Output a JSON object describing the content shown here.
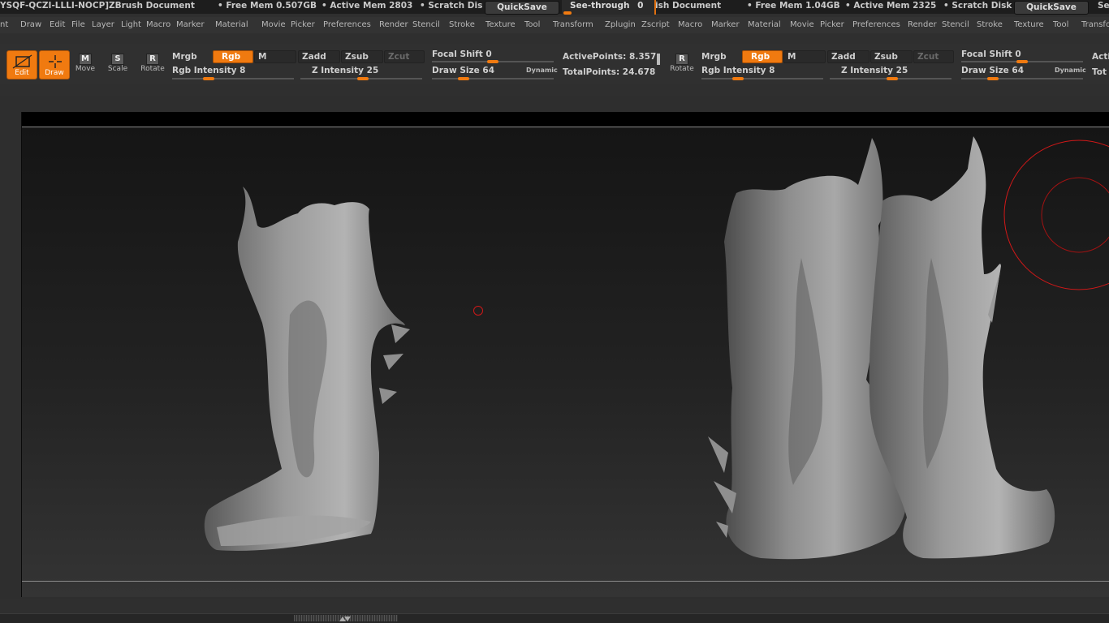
{
  "titlebar": {
    "left_id": "YSQF-QCZI-LLLI-NOCP]",
    "app_title": "ZBrush Document",
    "free_mem_1": "• Free Mem 0.507GB",
    "active_mem_1": "• Active Mem 2803",
    "scratch_1": "• Scratch Dis",
    "quicksave_1": "QuickSave",
    "see_through_label": "See-through",
    "see_through_value": "0",
    "app_title_2": "ish Document",
    "free_mem_2": "• Free Mem 1.04GB",
    "active_mem_2": "• Active Mem 2325",
    "scratch_2": "• Scratch Disk",
    "quicksave_2": "QuickSave",
    "see_trunc": "Se"
  },
  "menubar": {
    "items_1": [
      "nt",
      "Draw",
      "Edit",
      "File",
      "Layer",
      "Light",
      "Macro",
      "Marker",
      "Material",
      "Movie",
      "Picker",
      "Preferences",
      "Render",
      "Stencil",
      "Stroke",
      "Texture",
      "Tool",
      "Transform",
      "Zplugin",
      "Zscript"
    ],
    "items_2": [
      "Macro",
      "Marker",
      "Material",
      "Movie",
      "Picker",
      "Preferences",
      "Render",
      "Stencil",
      "Stroke",
      "Texture",
      "Tool",
      "Transfo"
    ]
  },
  "toolbar": {
    "edit_label": "Edit",
    "draw_label": "Draw",
    "move_label": "Move",
    "scale_label": "Scale",
    "rotate_label": "Rotate",
    "move_glyph": "M",
    "scale_glyph": "S",
    "rotate_glyph": "R",
    "mrgb": "Mrgb",
    "rgb": "Rgb",
    "m": "M",
    "zadd": "Zadd",
    "zsub": "Zsub",
    "zcut": "Zcut",
    "rgb_intensity": "Rgb Intensity 8",
    "z_intensity": "Z Intensity 25",
    "focal_shift": "Focal Shift 0",
    "draw_size": "Draw Size 64",
    "dynamic": "Dynamic",
    "active_points": "ActivePoints: 8.357",
    "total_points": "TotalPoints: 24.678",
    "rotate_label_2": "Rotate",
    "mrgb_2": "Mrgb",
    "rgb_2": "Rgb",
    "m_2": "M",
    "zadd_2": "Zadd",
    "zsub_2": "Zsub",
    "zcut_2": "Zcut",
    "rgb_intensity_2": "Rgb Intensity 8",
    "z_intensity_2": "Z Intensity 25",
    "focal_shift_2": "Focal Shift 0",
    "draw_size_2": "Draw Size 64",
    "dynamic_2": "Dynamic",
    "acti_trunc": "Acti",
    "tot_trunc": "Tot"
  },
  "colors": {
    "accent": "#f07a10",
    "brush_ring": "#d01818"
  }
}
